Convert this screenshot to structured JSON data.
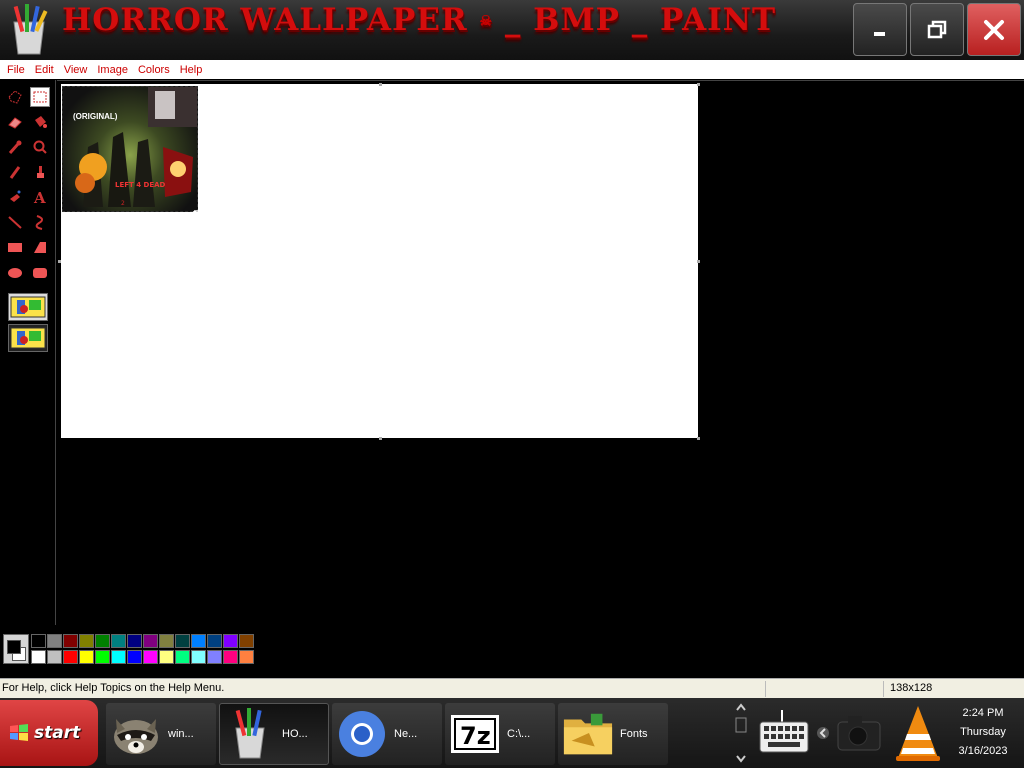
{
  "window": {
    "title": "HORROR WALLPAPER _ BMP _ PAINT",
    "title_parts": [
      "HORROR WALLPAPER ",
      " _ BMP _ PAINT"
    ],
    "minimize_icon": "minimize-icon",
    "maximize_icon": "restore-icon",
    "close_icon": "close-icon"
  },
  "menu": {
    "items": [
      "File",
      "Edit",
      "View",
      "Image",
      "Colors",
      "Help"
    ]
  },
  "toolbox": {
    "tools": [
      "free-form-select-icon",
      "rect-select-icon",
      "eraser-icon",
      "fill-icon",
      "pick-color-icon",
      "magnifier-icon",
      "pencil-icon",
      "brush-icon",
      "airbrush-icon",
      "text-icon",
      "line-icon",
      "curve-icon",
      "rectangle-icon",
      "polygon-icon",
      "ellipse-icon",
      "rounded-rect-icon"
    ],
    "selected_tool": "rect-select-icon"
  },
  "canvas": {
    "pasted_image_label": "(ORIGINAL)"
  },
  "palette": {
    "row1": [
      "#000000",
      "#808080",
      "#800000",
      "#808000",
      "#008000",
      "#008080",
      "#000080",
      "#800080",
      "#808040",
      "#004040",
      "#0080ff",
      "#004080",
      "#8000ff",
      "#804000"
    ],
    "row2": [
      "#ffffff",
      "#c0c0c0",
      "#ff0000",
      "#ffff00",
      "#00ff00",
      "#00ffff",
      "#0000ff",
      "#ff00ff",
      "#ffff80",
      "#00ff80",
      "#80ffff",
      "#8080ff",
      "#ff0080",
      "#ff8040"
    ]
  },
  "status": {
    "help_text": "For Help, click Help Topics on the Help Menu.",
    "size": "138x128"
  },
  "taskbar": {
    "start_label": "start",
    "tasks": [
      {
        "label": "win...",
        "icon": "raccoon-icon"
      },
      {
        "label": "HO...",
        "icon": "paint-icon"
      },
      {
        "label": "Ne...",
        "icon": "chrome-icon"
      },
      {
        "label": "C:\\...",
        "icon": "7zip-icon"
      },
      {
        "label": "Fonts",
        "icon": "folder-icon"
      }
    ]
  },
  "tray": {
    "time": "2:24 PM",
    "day": "Thursday",
    "date": "3/16/2023",
    "icons": [
      "keyboard-icon",
      "chevron-left-icon",
      "camera-icon",
      "vlc-icon"
    ]
  }
}
